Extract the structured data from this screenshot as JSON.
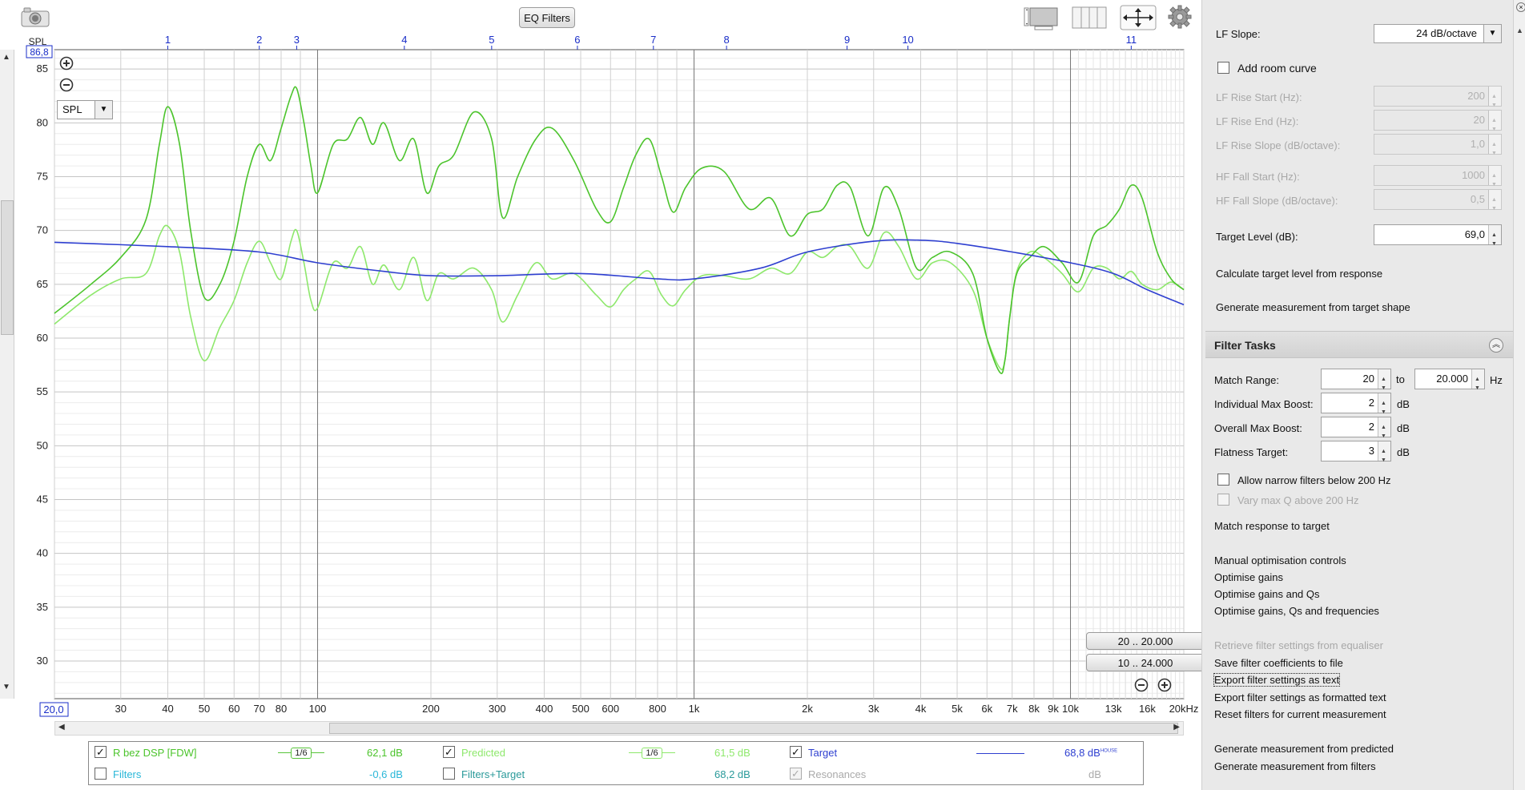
{
  "toolbar": {
    "eq_filters_label": "EQ Filters",
    "camera_icon": "camera-icon",
    "gear_icon": "gear-icon"
  },
  "colors": {
    "curve_green": "#4cc42c",
    "curve_light_green": "#8ee86c",
    "target_blue": "#2e3fd0",
    "grid": "#d8d8d8",
    "axis_label_blue": "#1a2ec8"
  },
  "plot": {
    "y_axis_title": "SPL",
    "y_top_value": "86,8",
    "x_start_value": "20,0",
    "spl_dropdown": "SPL",
    "range_buttons": [
      "20 .. 20.000",
      "10 .. 24.000"
    ]
  },
  "chart_data": {
    "type": "line",
    "title": "",
    "xlabel": "",
    "ylabel": "SPL",
    "x_scale": "log",
    "xlim": [
      20,
      20000
    ],
    "ylim": [
      26.5,
      86.8
    ],
    "grid": true,
    "x_tick_labels": [
      "30",
      "40",
      "50",
      "60",
      "70",
      "80",
      "100",
      "200",
      "300",
      "400",
      "500",
      "600",
      "800",
      "1k",
      "2k",
      "3k",
      "4k",
      "5k",
      "6k",
      "7k",
      "8k",
      "9k",
      "10k",
      "13k",
      "16k",
      "20kHz"
    ],
    "x_tick_values": [
      30,
      40,
      50,
      60,
      70,
      80,
      100,
      200,
      300,
      400,
      500,
      600,
      800,
      1000,
      2000,
      3000,
      4000,
      5000,
      6000,
      7000,
      8000,
      9000,
      10000,
      13000,
      16000,
      20000
    ],
    "y_tick_labels": [
      "85",
      "80",
      "75",
      "70",
      "65",
      "60",
      "55",
      "50",
      "45",
      "40",
      "35",
      "30"
    ],
    "y_tick_values": [
      85,
      80,
      75,
      70,
      65,
      60,
      55,
      50,
      45,
      40,
      35,
      30
    ],
    "filter_markers": [
      {
        "label": "1",
        "freq": 40
      },
      {
        "label": "2",
        "freq": 70
      },
      {
        "label": "3",
        "freq": 88
      },
      {
        "label": "4",
        "freq": 170
      },
      {
        "label": "5",
        "freq": 290
      },
      {
        "label": "6",
        "freq": 490
      },
      {
        "label": "7",
        "freq": 780
      },
      {
        "label": "8",
        "freq": 1220
      },
      {
        "label": "9",
        "freq": 2550
      },
      {
        "label": "10",
        "freq": 3700
      },
      {
        "label": "11",
        "freq": 14500
      }
    ],
    "series": [
      {
        "name": "R bez DSP [FDW]",
        "color": "#4cc42c",
        "x": [
          20,
          25,
          30,
          35,
          38,
          40,
          43,
          46,
          50,
          55,
          60,
          65,
          70,
          75,
          80,
          85,
          88,
          92,
          96,
          100,
          110,
          120,
          130,
          140,
          150,
          165,
          180,
          195,
          210,
          230,
          260,
          290,
          310,
          340,
          380,
          420,
          480,
          550,
          600,
          650,
          700,
          760,
          820,
          880,
          950,
          1050,
          1200,
          1400,
          1600,
          1800,
          2000,
          2200,
          2400,
          2600,
          2900,
          3200,
          3500,
          3900,
          4300,
          4800,
          5500,
          6000,
          6500,
          6700,
          6900,
          7200,
          7800,
          8500,
          9500,
          10500,
          11500,
          12500,
          13500,
          14500,
          15500,
          17000,
          18500,
          20000
        ],
        "y": [
          62.3,
          65,
          67.5,
          71,
          78,
          81.5,
          78,
          70,
          63.8,
          65,
          69,
          75,
          78,
          76.5,
          79.5,
          82.5,
          83.2,
          80,
          76,
          73.5,
          78,
          78.5,
          80.5,
          78,
          80,
          76.5,
          78.5,
          73.5,
          76,
          77,
          81,
          78.5,
          71.2,
          75,
          78.5,
          79.5,
          76.5,
          72,
          70.8,
          74,
          77,
          78.5,
          75,
          71.7,
          74,
          75.8,
          75.5,
          72,
          73,
          69.5,
          71.5,
          72,
          74.2,
          74,
          69.5,
          74,
          72,
          66.5,
          67.5,
          68,
          66,
          60,
          56.8,
          58,
          62,
          66,
          67.5,
          68.5,
          67,
          65.2,
          69.5,
          70.5,
          72,
          74.2,
          73,
          68,
          65.5,
          64.5
        ]
      },
      {
        "name": "Predicted",
        "color": "#8ee86c",
        "x": [
          20,
          25,
          30,
          35,
          38,
          40,
          43,
          46,
          50,
          55,
          60,
          65,
          70,
          75,
          80,
          85,
          88,
          92,
          96,
          100,
          110,
          120,
          130,
          140,
          150,
          165,
          180,
          195,
          210,
          230,
          260,
          290,
          310,
          340,
          380,
          420,
          480,
          550,
          600,
          650,
          700,
          760,
          820,
          880,
          950,
          1050,
          1200,
          1400,
          1600,
          1800,
          2000,
          2200,
          2400,
          2600,
          2900,
          3200,
          3500,
          3900,
          4300,
          4800,
          5500,
          6000,
          6500,
          6700,
          6900,
          7200,
          7800,
          8500,
          9500,
          10500,
          11500,
          12500,
          13500,
          14500,
          15500,
          17000,
          18500,
          20000
        ],
        "y": [
          61.3,
          64,
          65.5,
          66,
          69.5,
          70.4,
          68,
          62,
          57.9,
          61,
          63.5,
          67,
          69,
          67,
          65.5,
          69,
          70,
          67,
          63.5,
          62.8,
          67,
          66.5,
          68.5,
          65,
          66.8,
          64.5,
          67.5,
          63.5,
          66,
          65.5,
          66.5,
          64.5,
          61.5,
          64,
          67,
          65.5,
          66,
          64,
          62.9,
          64.5,
          65.5,
          66.2,
          64,
          63,
          64.5,
          65.8,
          65.8,
          65.5,
          66.5,
          66,
          68,
          67.5,
          68.5,
          68.5,
          66.5,
          69.8,
          68.5,
          65.5,
          67,
          67,
          64.5,
          60,
          57.2,
          58,
          62,
          66.2,
          68,
          67.5,
          66,
          64.3,
          66.5,
          66.5,
          65.5,
          66.2,
          65,
          64.5,
          65.2,
          64.5
        ]
      },
      {
        "name": "Target",
        "color": "#2e3fd0",
        "x": [
          20,
          40,
          70,
          100,
          150,
          200,
          300,
          500,
          800,
          1000,
          1500,
          2000,
          3000,
          4000,
          5000,
          7000,
          10000,
          13000,
          16000,
          20000
        ],
        "y": [
          68.9,
          68.5,
          68,
          67,
          66.2,
          65.8,
          65.8,
          66,
          65.5,
          65.5,
          66.5,
          68,
          69,
          69.1,
          68.8,
          68,
          67,
          66,
          64.5,
          63.1
        ]
      }
    ]
  },
  "legend": {
    "r_name": "R bez DSP [FDW]",
    "r_smoothing": "1/6",
    "r_level": "62,1 dB",
    "predicted_name": "Predicted",
    "predicted_smoothing": "1/6",
    "predicted_level": "61,5 dB",
    "target_name": "Target",
    "target_level": "68,8 dB",
    "target_curve_tag": "HOUSE",
    "filters_name": "Filters",
    "filters_level": "-0,6 dB",
    "filters_target_name": "Filters+Target",
    "filters_target_level": "68,2 dB",
    "resonances_name": "Resonances",
    "resonances_level": "dB"
  },
  "target_settings": {
    "lf_slope_label": "LF Slope:",
    "lf_slope_value": "24 dB/octave",
    "add_room_curve": "Add room curve",
    "lf_rise_start_label": "LF Rise Start (Hz):",
    "lf_rise_start_value": "200",
    "lf_rise_end_label": "LF Rise End (Hz):",
    "lf_rise_end_value": "20",
    "lf_rise_slope_label": "LF Rise Slope (dB/octave):",
    "lf_rise_slope_value": "1,0",
    "hf_fall_start_label": "HF Fall Start (Hz):",
    "hf_fall_start_value": "1000",
    "hf_fall_slope_label": "HF Fall Slope (dB/octave):",
    "hf_fall_slope_value": "0,5",
    "target_level_label": "Target Level (dB):",
    "target_level_value": "69,0",
    "calc_target": "Calculate target level from response",
    "gen_from_target": "Generate measurement from target shape"
  },
  "filter_tasks": {
    "title": "Filter Tasks",
    "match_range_label": "Match Range:",
    "match_range_from": "20",
    "to_label": "to",
    "match_range_to": "20.000",
    "hz_label": "Hz",
    "ind_max_boost_label": "Individual Max Boost:",
    "ind_max_boost_value": "2",
    "overall_max_boost_label": "Overall Max Boost:",
    "overall_max_boost_value": "2",
    "flatness_target_label": "Flatness Target:",
    "flatness_target_value": "3",
    "db_unit": "dB",
    "allow_narrow": "Allow narrow filters below 200 Hz",
    "vary_max_q": "Vary max Q above 200 Hz",
    "match_response": "Match response to target",
    "manual_controls": "Manual optimisation controls",
    "optimise_gains": "Optimise gains",
    "optimise_gains_qs": "Optimise gains and Qs",
    "optimise_all": "Optimise gains, Qs and frequencies",
    "retrieve": "Retrieve filter settings from equaliser",
    "save_coeffs": "Save filter coefficients to file",
    "export_text": "Export filter settings as text",
    "export_formatted": "Export filter settings as formatted text",
    "reset_filters": "Reset filters for current measurement",
    "gen_predicted": "Generate measurement from predicted",
    "gen_filters": "Generate measurement from filters"
  }
}
